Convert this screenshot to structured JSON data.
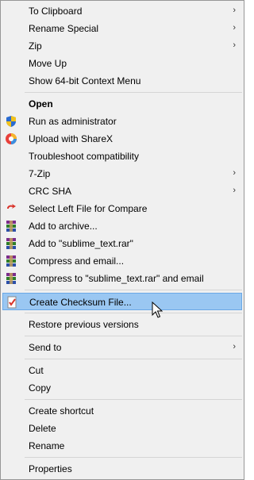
{
  "menu": {
    "items": [
      {
        "label": "To Clipboard",
        "submenu": "›"
      },
      {
        "label": "Rename Special",
        "submenu": "›"
      },
      {
        "label": "Zip",
        "submenu": "›"
      },
      {
        "label": "Move Up"
      },
      {
        "label": "Show 64-bit Context Menu"
      },
      {
        "label": "Open"
      },
      {
        "label": "Run as administrator",
        "icon": "shield-icon"
      },
      {
        "label": "Upload with ShareX",
        "icon": "sharex-icon"
      },
      {
        "label": "Troubleshoot compatibility"
      },
      {
        "label": "7-Zip",
        "submenu": "›"
      },
      {
        "label": "CRC SHA",
        "submenu": "›"
      },
      {
        "label": "Select Left File for Compare",
        "icon": "compare-icon"
      },
      {
        "label": "Add to archive...",
        "icon": "winrar-icon"
      },
      {
        "label": "Add to \"sublime_text.rar\"",
        "icon": "winrar-icon"
      },
      {
        "label": "Compress and email...",
        "icon": "winrar-icon"
      },
      {
        "label": "Compress to \"sublime_text.rar\" and email",
        "icon": "winrar-icon"
      },
      {
        "label": "Create Checksum File...",
        "icon": "checksum-icon",
        "state": "highlighted"
      },
      {
        "label": "Restore previous versions"
      },
      {
        "label": "Send to",
        "submenu": "›"
      },
      {
        "label": "Cut"
      },
      {
        "label": "Copy"
      },
      {
        "label": "Create shortcut"
      },
      {
        "label": "Delete"
      },
      {
        "label": "Rename"
      },
      {
        "label": "Properties"
      }
    ]
  },
  "colors": {
    "menu_background": "#f0f0f0",
    "highlight": "#9ac7f2",
    "separator": "#d5d5d5"
  }
}
